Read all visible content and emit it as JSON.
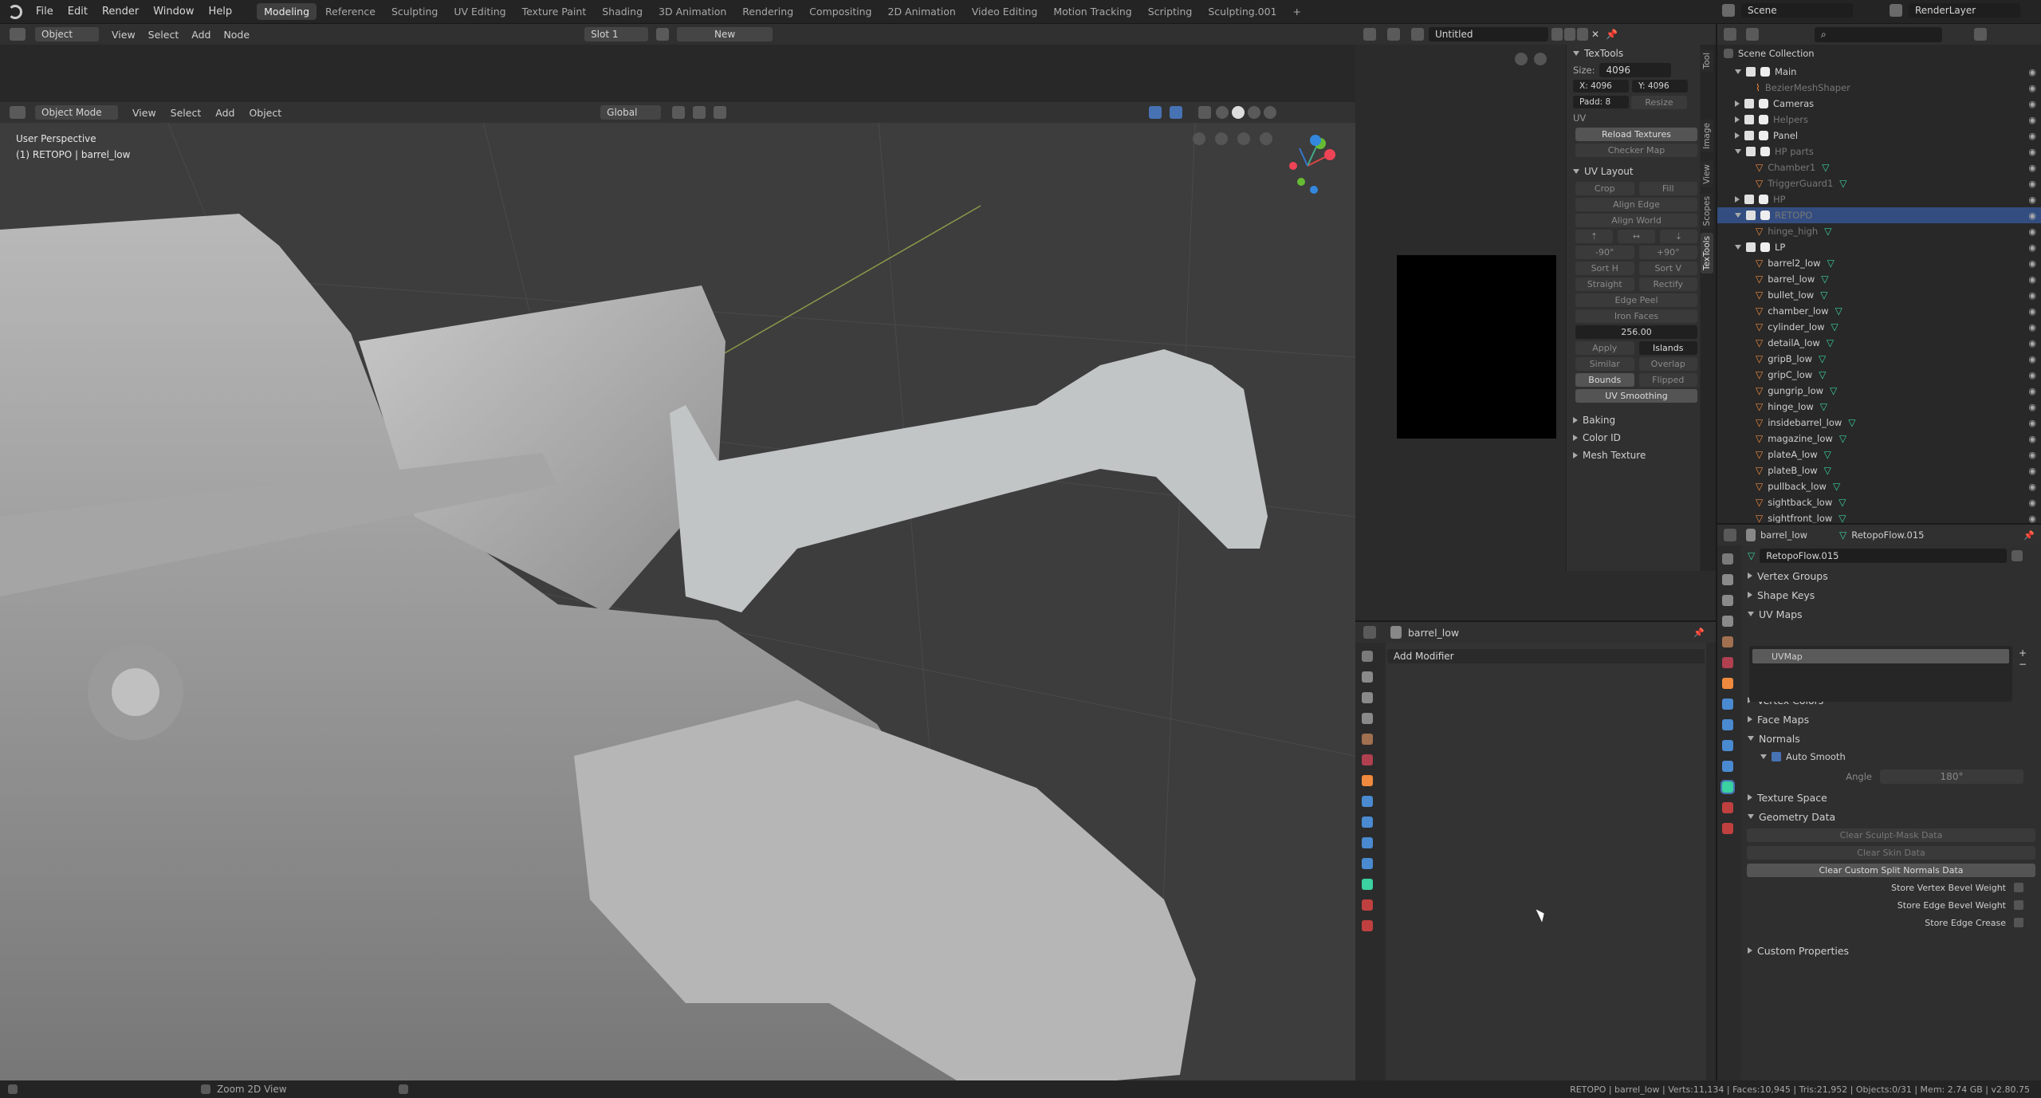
{
  "topbar": {
    "menus": [
      "File",
      "Edit",
      "Render",
      "Window",
      "Help"
    ],
    "workspaces": [
      "Modeling",
      "Reference",
      "Sculpting",
      "UV Editing",
      "Texture Paint",
      "Shading",
      "3D Animation",
      "Rendering",
      "Compositing",
      "2D Animation",
      "Video Editing",
      "Motion Tracking",
      "Scripting",
      "Sculpting.001"
    ],
    "active_workspace": "Modeling",
    "scene": "Scene",
    "view_layer": "RenderLayer"
  },
  "image_editor_header": {
    "mode": "Object",
    "menus": [
      "View",
      "Select",
      "Add",
      "Node"
    ],
    "slot": "Slot 1",
    "new_label": "New"
  },
  "viewport_header": {
    "mode": "Object Mode",
    "menus": [
      "View",
      "Select",
      "Add",
      "Object"
    ],
    "orientation": "Global"
  },
  "viewport": {
    "perspective": "User Perspective",
    "object_info": "(1) RETOPO | barrel_low"
  },
  "uv_editor_header": {
    "image_name": "Untitled"
  },
  "texttools": {
    "title": "TexTools",
    "size_label": "Size:",
    "size_value": "4096",
    "x_label": "X:",
    "x_value": "4096",
    "y_label": "Y:",
    "y_value": "4096",
    "padding_label": "Padd:",
    "padding_value": "8",
    "resize_label": "Resize",
    "uv_label": "UV",
    "reload_textures": "Reload Textures",
    "checker_map": "Checker Map",
    "uv_layout_title": "UV Layout",
    "crop": "Crop",
    "fill": "Fill",
    "align_edge": "Align Edge",
    "align_world": "Align World",
    "rot_neg": "-90°",
    "rot_pos": "+90°",
    "sort_h": "Sort H",
    "sort_v": "Sort V",
    "straight": "Straight",
    "rectify": "Rectify",
    "edge_peel": "Edge Peel",
    "iron_faces": "Iron Faces",
    "texel_value": "256.00",
    "apply": "Apply",
    "islands": "Islands",
    "similar": "Similar",
    "overlap": "Overlap",
    "bounds": "Bounds",
    "flipped": "Flipped",
    "uv_smoothing": "UV Smoothing",
    "sections": [
      "Baking",
      "Color ID",
      "Mesh Texture"
    ],
    "side_tabs": [
      "Tool",
      "Image",
      "View",
      "Scopes",
      "TexTools"
    ]
  },
  "modifiers": {
    "object": "barrel_low",
    "add_modifier": "Add Modifier"
  },
  "outliner": {
    "title": "Scene Collection",
    "rows": [
      {
        "name": "Main",
        "depth": 1,
        "kind": "collection",
        "checked": true,
        "expanded": true,
        "dim": false
      },
      {
        "name": "BezierMeshShaper",
        "depth": 2,
        "kind": "curve",
        "checked": false,
        "dim": true
      },
      {
        "name": "Cameras",
        "depth": 1,
        "kind": "collection",
        "checked": true,
        "dim": false
      },
      {
        "name": "Helpers",
        "depth": 1,
        "kind": "collection",
        "checked": true,
        "dim": true
      },
      {
        "name": "Panel",
        "depth": 1,
        "kind": "collection",
        "checked": true,
        "dim": false
      },
      {
        "name": "HP parts",
        "depth": 1,
        "kind": "collection",
        "checked": true,
        "expanded": true,
        "dim": true
      },
      {
        "name": "Chamber1",
        "depth": 2,
        "kind": "mesh",
        "dim": true
      },
      {
        "name": "TriggerGuard1",
        "depth": 2,
        "kind": "mesh",
        "dim": true
      },
      {
        "name": "HP",
        "depth": 1,
        "kind": "collection",
        "checked": true,
        "dim": true
      },
      {
        "name": "RETOPO",
        "depth": 1,
        "kind": "collection",
        "checked": true,
        "expanded": true,
        "selected": true,
        "dim": true
      },
      {
        "name": "hinge_high",
        "depth": 2,
        "kind": "mesh",
        "dim": true
      },
      {
        "name": "LP",
        "depth": 1,
        "kind": "collection",
        "checked": true,
        "expanded": true,
        "dim": false
      },
      {
        "name": "barrel2_low",
        "depth": 2,
        "kind": "mesh"
      },
      {
        "name": "barrel_low",
        "depth": 2,
        "kind": "mesh"
      },
      {
        "name": "bullet_low",
        "depth": 2,
        "kind": "mesh"
      },
      {
        "name": "chamber_low",
        "depth": 2,
        "kind": "mesh"
      },
      {
        "name": "cylinder_low",
        "depth": 2,
        "kind": "mesh"
      },
      {
        "name": "detailA_low",
        "depth": 2,
        "kind": "mesh"
      },
      {
        "name": "gripB_low",
        "depth": 2,
        "kind": "mesh"
      },
      {
        "name": "gripC_low",
        "depth": 2,
        "kind": "mesh"
      },
      {
        "name": "gungrip_low",
        "depth": 2,
        "kind": "mesh"
      },
      {
        "name": "hinge_low",
        "depth": 2,
        "kind": "mesh"
      },
      {
        "name": "insidebarrel_low",
        "depth": 2,
        "kind": "mesh"
      },
      {
        "name": "magazine_low",
        "depth": 2,
        "kind": "mesh"
      },
      {
        "name": "plateA_low",
        "depth": 2,
        "kind": "mesh"
      },
      {
        "name": "plateB_low",
        "depth": 2,
        "kind": "mesh"
      },
      {
        "name": "pullback_low",
        "depth": 2,
        "kind": "mesh"
      },
      {
        "name": "sightback_low",
        "depth": 2,
        "kind": "mesh"
      },
      {
        "name": "sightfront_low",
        "depth": 2,
        "kind": "mesh"
      }
    ]
  },
  "properties": {
    "object": "barrel_low",
    "mesh": "RetopoFlow.015",
    "datablock": "RetopoFlow.015",
    "vertex_groups": "Vertex Groups",
    "shape_keys": "Shape Keys",
    "uv_maps": "UV Maps",
    "uvmap_name": "UVMap",
    "vertex_colors": "Vertex Colors",
    "face_maps": "Face Maps",
    "normals": "Normals",
    "auto_smooth": "Auto Smooth",
    "angle_label": "Angle",
    "angle_value": "180°",
    "texture_space": "Texture Space",
    "geometry_data": "Geometry Data",
    "clear_sculpt": "Clear Sculpt-Mask Data",
    "clear_skin": "Clear Skin Data",
    "clear_split": "Clear Custom Split Normals Data",
    "store_vertex_bevel": "Store Vertex Bevel Weight",
    "store_edge_bevel": "Store Edge Bevel Weight",
    "store_edge_crease": "Store Edge Crease",
    "custom_properties": "Custom Properties"
  },
  "status": {
    "left_hint": "Zoom 2D View",
    "stats": "RETOPO | barrel_low | Verts:11,134 | Faces:10,945 | Tris:21,952 | Objects:0/31 | Mem: 2.74 GB | v2.80.75"
  },
  "colors": {
    "accent_blue": "#4772b3",
    "selected_row": "#334d80",
    "mesh_orange": "#f08a3e",
    "vgroup_green": "#3bd1a0"
  }
}
